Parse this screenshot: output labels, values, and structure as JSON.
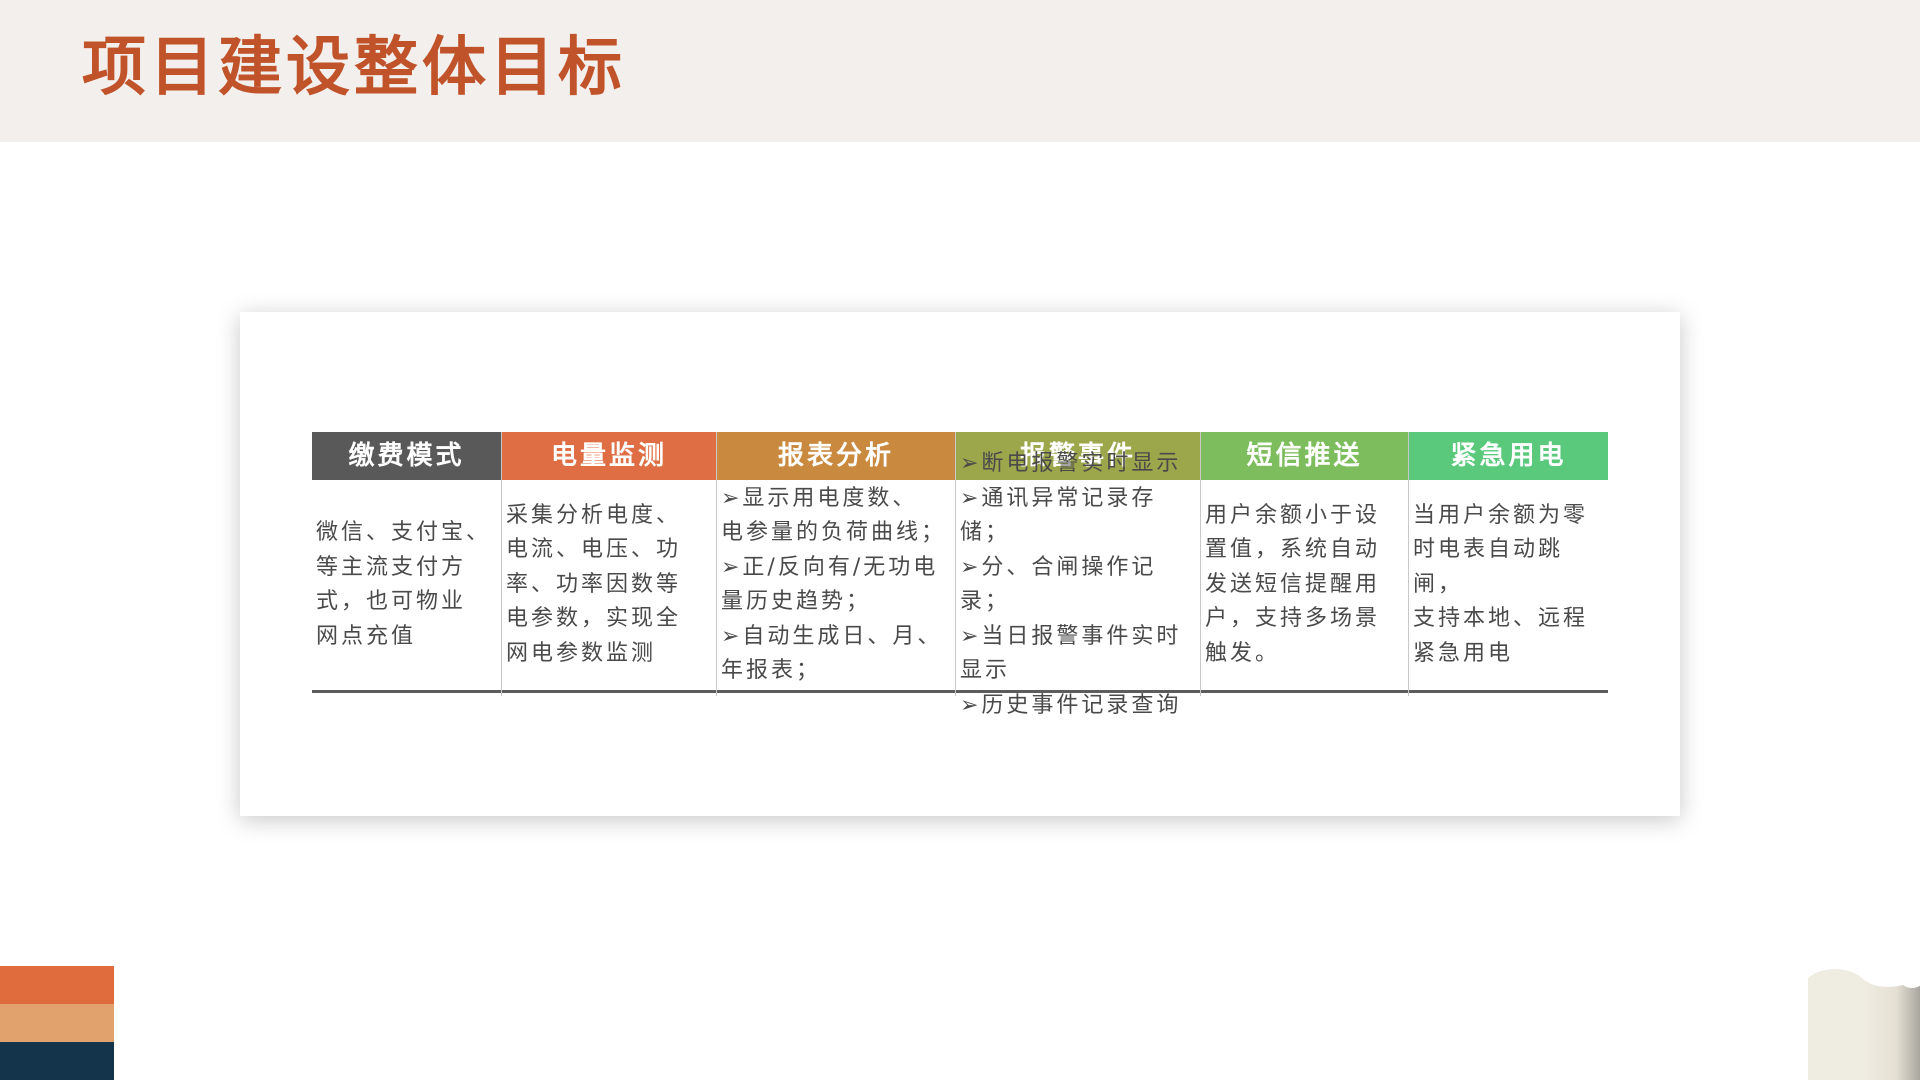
{
  "slide": {
    "title": "项目建设整体目标"
  },
  "colors": {
    "title": "#c0532a",
    "header_band": "#f3efec",
    "deco_1": "#e06b3c",
    "deco_2": "#e2a26e",
    "deco_3": "#13344a"
  },
  "columns": [
    {
      "header": "缴费模式",
      "color": "#595959",
      "body": "微信、支付宝、\n等主流支付方\n式，也可物业\n网点充值"
    },
    {
      "header": "电量监测",
      "color": "#e06e44",
      "body": "采集分析电度、\n电流、电压、功\n率、功率因数等\n电参数，实现全\n网电参数监测"
    },
    {
      "header": "报表分析",
      "color": "#c9893f",
      "body": "➢显示用电度数、\n电参量的负荷曲线；\n➢正/反向有/无功电\n量历史趋势；\n➢自动生成日、月、\n年报表；"
    },
    {
      "header": "报警事件",
      "color": "#9ca64b",
      "body": "➢断电报警实时显示\n➢通讯异常记录存储；\n➢分、合闸操作记录；\n➢当日报警事件实时\n显示\n➢历史事件记录查询"
    },
    {
      "header": "短信推送",
      "color": "#7ebd5d",
      "body": "用户余额小于设\n置值，系统自动\n发送短信提醒用\n户，支持多场景\n触发。"
    },
    {
      "header": "紧急用电",
      "color": "#5ac97c",
      "body": "当用户余额为零\n时电表自动跳闸，\n支持本地、远程\n紧急用电"
    }
  ]
}
